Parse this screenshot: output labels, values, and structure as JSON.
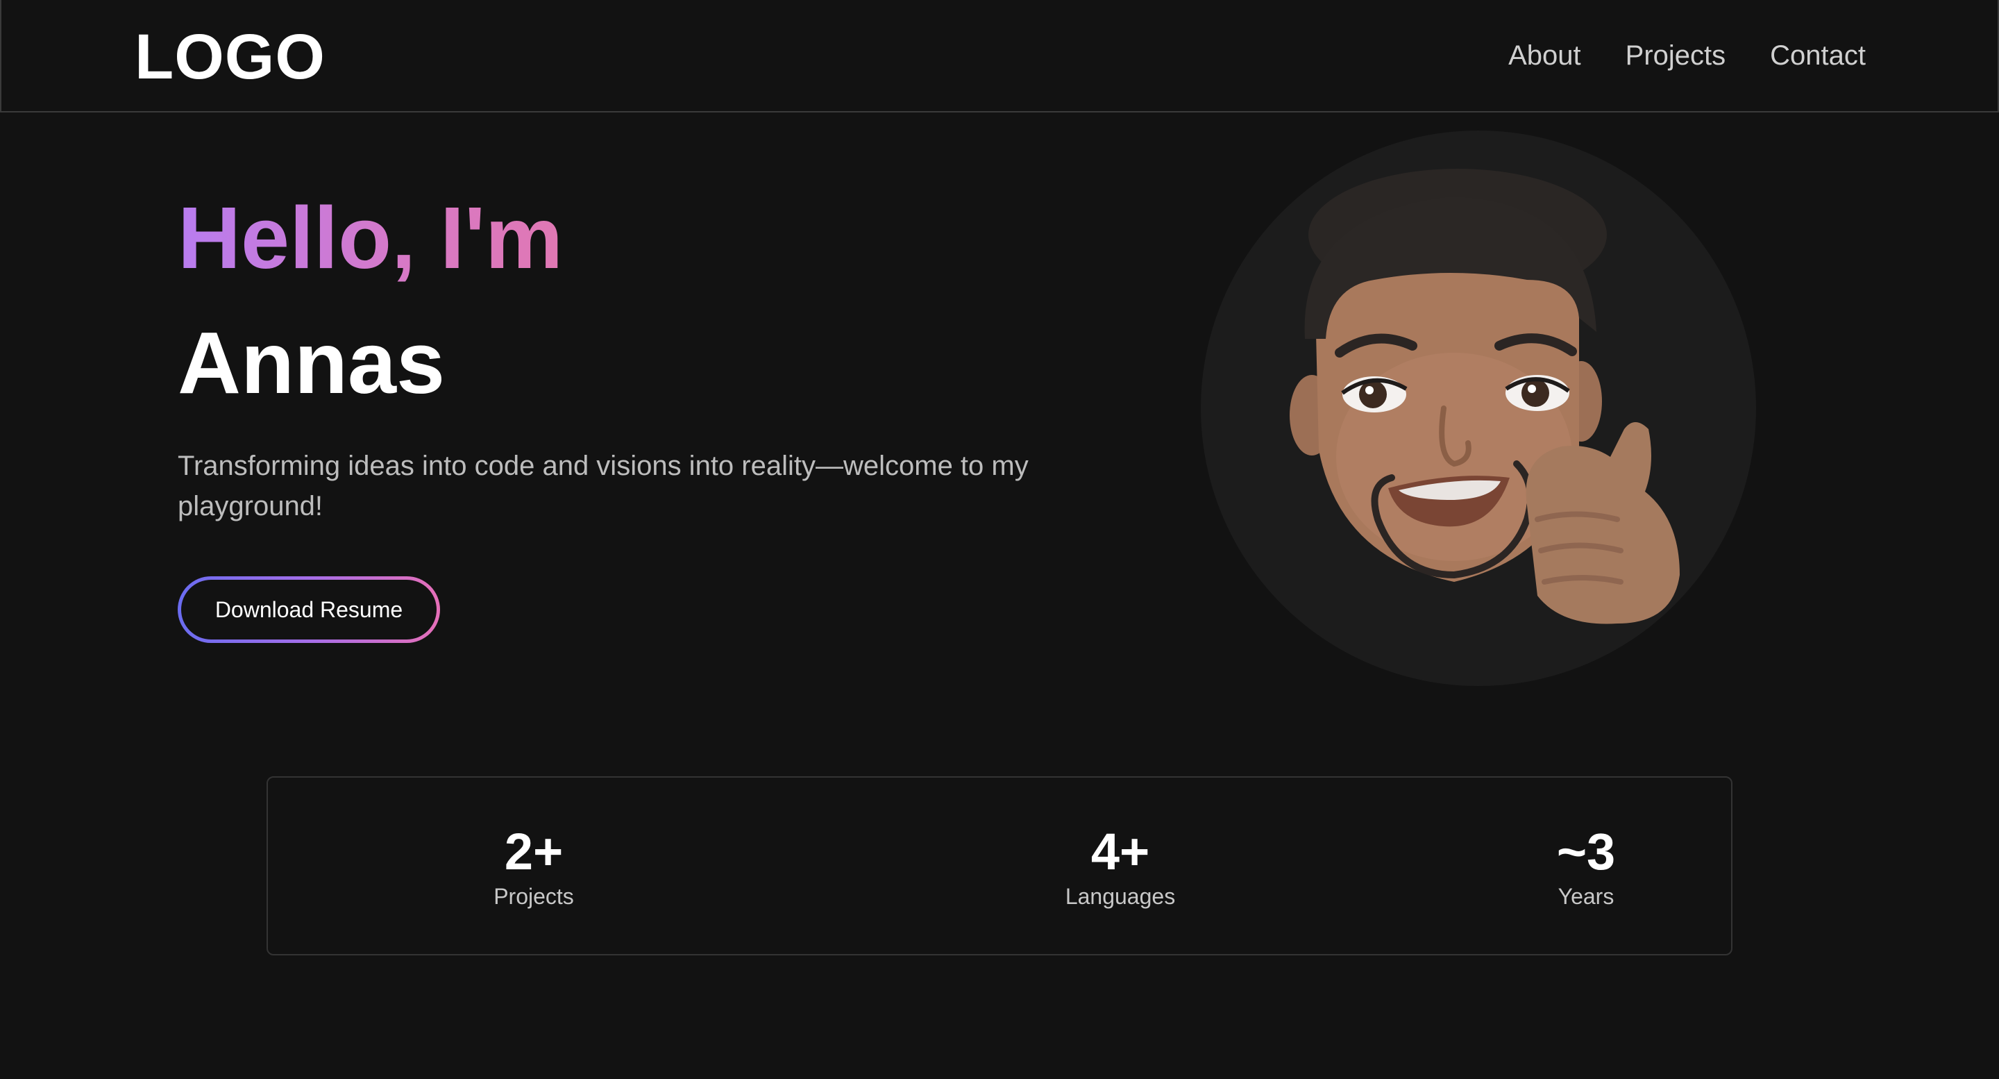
{
  "header": {
    "logo": "LOGO",
    "nav": [
      {
        "label": "About"
      },
      {
        "label": "Projects"
      },
      {
        "label": "Contact"
      }
    ]
  },
  "hero": {
    "greeting": "Hello, I'm",
    "name": "Annas",
    "tagline": "Transforming ideas into code and visions into reality—welcome to my playground!",
    "resume_button": "Download Resume"
  },
  "avatar": {
    "icon": "memoji-thumbs-up-avatar"
  },
  "stats": [
    {
      "value": "2+",
      "label": "Projects"
    },
    {
      "value": "4+",
      "label": "Languages"
    },
    {
      "value": "~3",
      "label": "Years"
    }
  ],
  "colors": {
    "background": "#121212",
    "greeting_gradient_start": "#b87cf0",
    "greeting_gradient_end": "#e078b3",
    "button_gradient_start": "#6a6cf0",
    "button_gradient_end": "#e66fb8"
  }
}
